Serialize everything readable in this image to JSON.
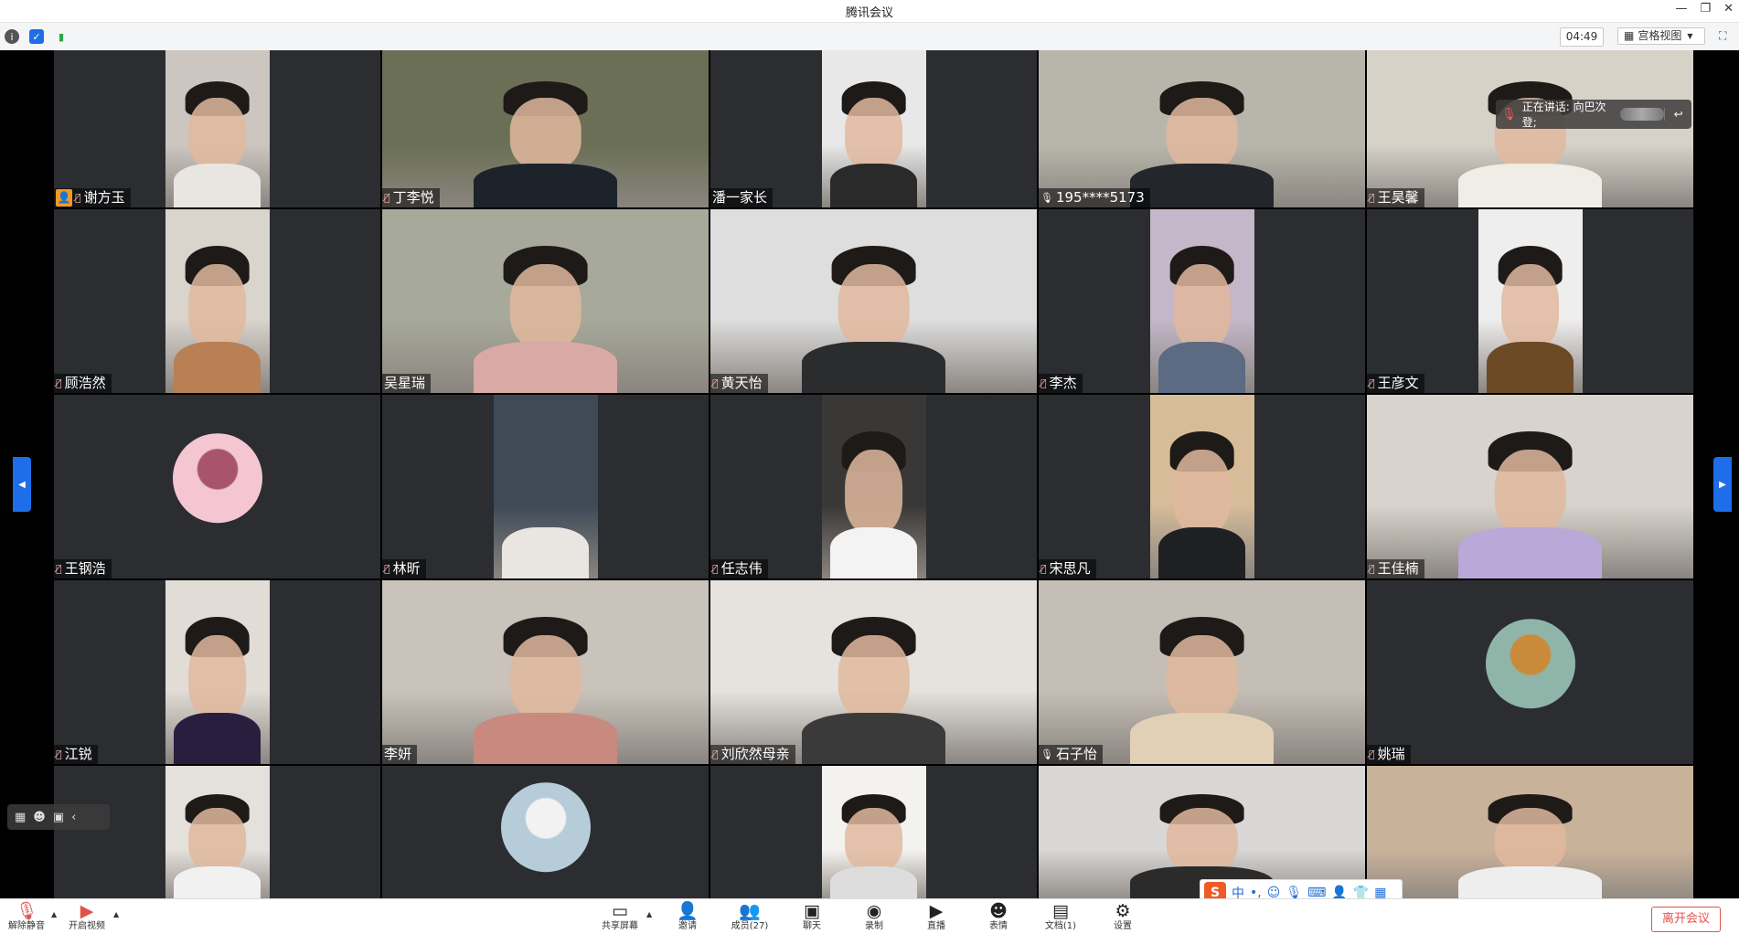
{
  "window": {
    "title": "腾讯会议"
  },
  "infobar": {
    "timer": "04:49",
    "view_label": "宫格视图"
  },
  "speaking": {
    "label": "正在讲话: 向巴次登;"
  },
  "participants": [
    {
      "name": "谢方玉",
      "mic": "muted",
      "host": true,
      "type": "portrait",
      "bg": "#cdc6c0",
      "shirt": "#e9e6e2"
    },
    {
      "name": "丁李悦",
      "mic": "muted",
      "type": "full",
      "bg": "#6b6f55",
      "shirt": "#1c232b"
    },
    {
      "name": "潘一家长",
      "mic": "none",
      "type": "portrait",
      "bg": "#e8e8e8",
      "shirt": "#2a2a2a"
    },
    {
      "name": "195****5173",
      "mic": "on",
      "type": "full",
      "bg": "#b8b6aa",
      "shirt": "#23262b"
    },
    {
      "name": "王昊馨",
      "mic": "muted",
      "type": "full",
      "bg": "#d7d2c8",
      "shirt": "#f0ece6"
    },
    {
      "name": "顾浩然",
      "mic": "muted",
      "type": "portrait",
      "bg": "#d9d4cc",
      "shirt": "#b98055"
    },
    {
      "name": "吴星瑞",
      "mic": "none",
      "type": "full",
      "bg": "#a7a99a",
      "shirt": "#d9a9a6"
    },
    {
      "name": "黄天怡",
      "mic": "muted",
      "type": "full",
      "bg": "#dedede",
      "shirt": "#2a2c2e"
    },
    {
      "name": "李杰",
      "mic": "muted",
      "type": "portrait",
      "bg": "#c3b7c9",
      "shirt": "#5c6a82"
    },
    {
      "name": "王彦文",
      "mic": "muted",
      "type": "portrait",
      "bg": "#efeeee",
      "shirt": "#6b4a25"
    },
    {
      "name": "王钢浩",
      "mic": "muted",
      "type": "avatar",
      "avatar_bg": "#f3c6d2",
      "avatar_fg": "#a8546e"
    },
    {
      "name": "林昕",
      "mic": "muted",
      "type": "portrait",
      "bg": "#3e4a56",
      "shirt": "#e9e6e2",
      "noface": true
    },
    {
      "name": "任志伟",
      "mic": "muted",
      "type": "portrait",
      "bg": "#3a3836",
      "shirt": "#f3f3f3"
    },
    {
      "name": "宋思凡",
      "mic": "muted",
      "type": "portrait",
      "bg": "#d6bc98",
      "shirt": "#1f2022"
    },
    {
      "name": "王佳楠",
      "mic": "muted",
      "type": "full",
      "bg": "#d8d4cd",
      "shirt": "#b9a8d8"
    },
    {
      "name": "江锐",
      "mic": "muted",
      "type": "portrait",
      "bg": "#e1dcd6",
      "shirt": "#2a1e3f"
    },
    {
      "name": "李妍",
      "mic": "none",
      "type": "full",
      "bg": "#c9c3bb",
      "shirt": "#c88a7e"
    },
    {
      "name": "刘欣然母亲",
      "mic": "muted",
      "type": "full",
      "bg": "#e6e3de",
      "shirt": "#3a3a3a"
    },
    {
      "name": "石子怡",
      "mic": "on",
      "type": "full",
      "bg": "#c5beb6",
      "shirt": "#e1d0b6"
    },
    {
      "name": "姚瑞",
      "mic": "muted",
      "type": "avatar",
      "avatar_bg": "#8fb5a8",
      "avatar_fg": "#c98b3a"
    },
    {
      "name": "",
      "mic": "none",
      "type": "portrait",
      "bg": "#e4e0dc",
      "shirt": "#f1f1f1"
    },
    {
      "name": "",
      "mic": "none",
      "type": "avatar",
      "avatar_bg": "#b7ccd9",
      "avatar_fg": "#f2f2f2"
    },
    {
      "name": "",
      "mic": "none",
      "type": "portrait",
      "bg": "#f4f2ee",
      "shirt": "#ddd"
    },
    {
      "name": "",
      "mic": "none",
      "type": "full",
      "bg": "#d9d7d5",
      "shirt": "#2b2b2b"
    },
    {
      "name": "",
      "mic": "none",
      "type": "full",
      "bg": "#c9b29a",
      "shirt": "#eeeeee"
    }
  ],
  "ime": {
    "cn": "中",
    "punct": "•,"
  },
  "toolbar": {
    "unmute_label": "解除静音",
    "video_label": "开启视频",
    "share_label": "共享屏幕",
    "invite_label": "邀请",
    "members_label": "成员(27)",
    "chat_label": "聊天",
    "record_label": "录制",
    "live_label": "直播",
    "reaction_label": "表情",
    "docs_label": "文档(1)",
    "settings_label": "设置",
    "leave_label": "离开会议"
  },
  "colors": {
    "accent": "#1d6ee8",
    "leave": "#e0514b",
    "host": "#f39a1e"
  }
}
